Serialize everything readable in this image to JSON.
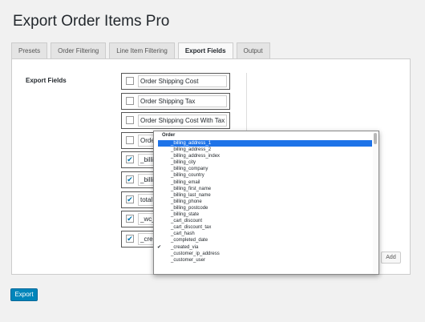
{
  "page": {
    "title": "Export Order Items Pro"
  },
  "tabs": [
    {
      "label": "Presets",
      "active": false
    },
    {
      "label": "Order Filtering",
      "active": false
    },
    {
      "label": "Line Item Filtering",
      "active": false
    },
    {
      "label": "Export Fields",
      "active": true
    },
    {
      "label": "Output",
      "active": false
    }
  ],
  "export_fields": {
    "label": "Export Fields",
    "rows": [
      {
        "checked": false,
        "text": "Order Shipping Cost"
      },
      {
        "checked": false,
        "text": "Order Shipping Tax"
      },
      {
        "checked": false,
        "text": "Order Shipping Cost With Tax"
      },
      {
        "checked": false,
        "text": "Orde"
      },
      {
        "checked": true,
        "text": "_billi"
      },
      {
        "checked": true,
        "text": "_billi"
      },
      {
        "checked": true,
        "text": "total"
      },
      {
        "checked": true,
        "text": "_wc_"
      },
      {
        "checked": true,
        "text": "_crea"
      }
    ],
    "add_label": "Add",
    "check_glyph": "✔"
  },
  "dropdown": {
    "group_label": "Order",
    "options": [
      {
        "label": "_billing_address_1",
        "selected": true,
        "checked": false
      },
      {
        "label": "_billing_address_2",
        "selected": false,
        "checked": false
      },
      {
        "label": "_billing_address_index",
        "selected": false,
        "checked": false
      },
      {
        "label": "_billing_city",
        "selected": false,
        "checked": false
      },
      {
        "label": "_billing_company",
        "selected": false,
        "checked": false
      },
      {
        "label": "_billing_country",
        "selected": false,
        "checked": false
      },
      {
        "label": "_billing_email",
        "selected": false,
        "checked": false
      },
      {
        "label": "_billing_first_name",
        "selected": false,
        "checked": false
      },
      {
        "label": "_billing_last_name",
        "selected": false,
        "checked": false
      },
      {
        "label": "_billing_phone",
        "selected": false,
        "checked": false
      },
      {
        "label": "_billing_postcode",
        "selected": false,
        "checked": false
      },
      {
        "label": "_billing_state",
        "selected": false,
        "checked": false
      },
      {
        "label": "_cart_discount",
        "selected": false,
        "checked": false
      },
      {
        "label": "_cart_discount_tax",
        "selected": false,
        "checked": false
      },
      {
        "label": "_cart_hash",
        "selected": false,
        "checked": false
      },
      {
        "label": "_completed_date",
        "selected": false,
        "checked": false
      },
      {
        "label": "_created_via",
        "selected": false,
        "checked": true
      },
      {
        "label": "_customer_ip_address",
        "selected": false,
        "checked": false
      },
      {
        "label": "_customer_user",
        "selected": false,
        "checked": false
      }
    ],
    "check_glyph": "✔"
  },
  "actions": {
    "export_label": "Export"
  },
  "colors": {
    "primary_button": "#0085ba",
    "selected_option": "#1e73e8",
    "check": "#0073aa"
  }
}
